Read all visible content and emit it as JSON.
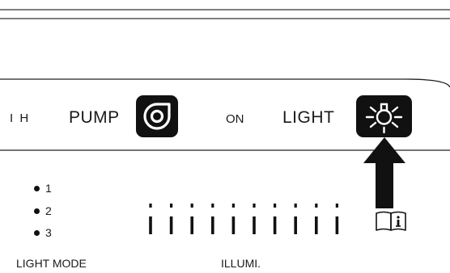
{
  "panel": {
    "left_label": "I H",
    "pump_label": "PUMP",
    "on_label": "ON",
    "light_label": "LIGHT"
  },
  "light_mode": {
    "options": [
      "1",
      "2",
      "3"
    ],
    "caption": "LIGHT MODE"
  },
  "illumination": {
    "caption": "ILLUMI.",
    "level_count": 10
  },
  "icons": {
    "pump": "pump-icon",
    "light": "light-bulb-icon",
    "arrow": "up-arrow",
    "manual": "manual-book-icon"
  },
  "colors": {
    "ink": "#111111",
    "line": "#333333"
  }
}
